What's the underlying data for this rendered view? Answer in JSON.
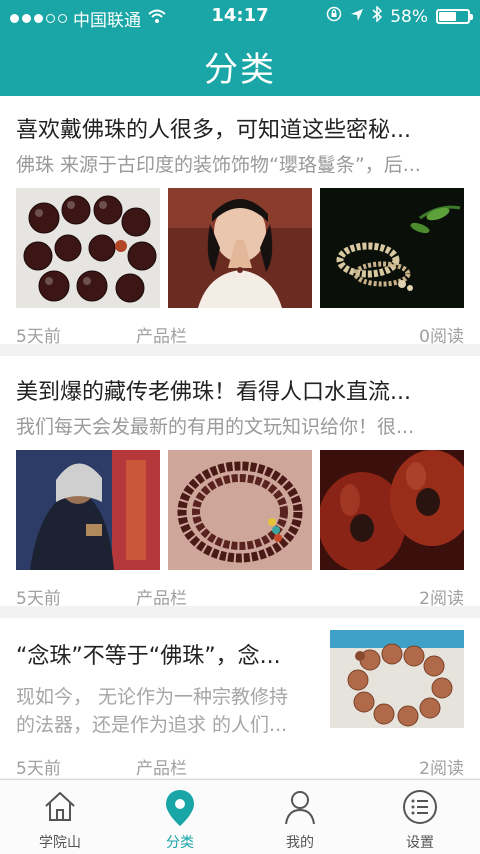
{
  "status_bar": {
    "carrier": "中国联通",
    "time": "14:17",
    "battery": "58%"
  },
  "header": {
    "title": "分类"
  },
  "articles": [
    {
      "title": "喜欢戴佛珠的人很多，可知道这些密秘...",
      "summary": "佛珠 来源于古印度的装饰饰物“瓔珞鬘条”，后...",
      "time": "5天前",
      "category": "产品栏",
      "reads": "0阅读"
    },
    {
      "title": "美到爆的藏传老佛珠！看得人口水直流...",
      "summary": "我们每天会发最新的有用的文玩知识给你！很...",
      "time": "5天前",
      "category": "产品栏",
      "reads": "2阅读"
    },
    {
      "title": "“念珠”不等于“佛珠”，念...",
      "summary_line1": "现如今，   无论作为一种宗教修持",
      "summary_line2": "的法器，还是作为追求  的人们...",
      "time": "5天前",
      "category": "产品栏",
      "reads": "2阅读"
    }
  ],
  "tabbar": {
    "tabs": [
      {
        "label": "学院山",
        "icon": "home-icon"
      },
      {
        "label": "分类",
        "icon": "location-pin-icon"
      },
      {
        "label": "我的",
        "icon": "user-icon"
      },
      {
        "label": "设置",
        "icon": "list-menu-icon"
      }
    ],
    "active_index": 1,
    "accent_color": "#1aa6a6"
  }
}
